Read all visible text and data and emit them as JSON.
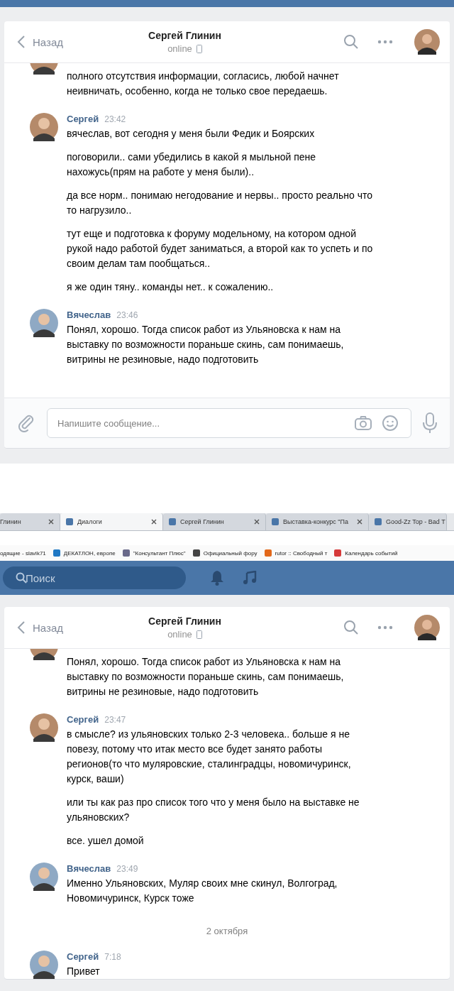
{
  "sections": [
    {
      "kind": "dialog",
      "header": {
        "back": "Назад",
        "name": "Сергей Глинин",
        "status": "online"
      },
      "messages": [
        {
          "kind": "continuation",
          "paragraphs": [
            "полного отсутствия информации, согласись, любой начнет неивничать, особенно, когда не только свое передаешь."
          ]
        },
        {
          "kind": "message",
          "author": "Сергей",
          "time": "23:42",
          "paragraphs": [
            "вячеслав, вот сегодня у меня были Федик и Боярских",
            "поговорили.. сами убедились в какой я мыльной пене нахожусь(прям на работе у меня были)..",
            "да все норм.. понимаю негодование и нервы.. просто реально что то нагрузило..",
            "тут еще и подготовка к форуму модельному, на котором одной рукой надо работой будет заниматься, а второй как то успеть и по своим делам там пообщаться..",
            "я же один тяну.. команды нет.. к сожалению.."
          ]
        },
        {
          "kind": "message",
          "author": "Вячеслав",
          "time": "23:46",
          "paragraphs": [
            "Понял, хорошо. Тогда список работ из Ульяновска к нам на выставку по возможности пораньше скинь, сам понимаешь, витрины не резиновые, надо подготовить"
          ]
        }
      ],
      "composer": {
        "placeholder": "Напишите сообщение..."
      }
    },
    {
      "kind": "browser",
      "tabs": [
        {
          "title": "Глинин",
          "selected": false
        },
        {
          "title": "Диалоги",
          "selected": true
        },
        {
          "title": "Сергей Глинин",
          "selected": false
        },
        {
          "title": "Выставка-конкурс \"Па",
          "selected": false
        },
        {
          "title": "Good-Zz Top - Bad T",
          "selected": false
        }
      ],
      "bookmarks": [
        "одящие - slavik71",
        "ДЕКАТЛОН, европе",
        "\"Консультант Плюс\"",
        "Официальный фору",
        "rutor :: Свободный т",
        "Календарь событий"
      ],
      "search": {
        "placeholder": "Поиск"
      }
    },
    {
      "kind": "dialog",
      "header": {
        "back": "Назад",
        "name": "Сергей Глинин",
        "status": "online"
      },
      "messages": [
        {
          "kind": "continuation",
          "paragraphs": [
            "Понял, хорошо. Тогда список работ из Ульяновска к нам на выставку по возможности пораньше скинь, сам понимаешь, витрины не резиновые, надо подготовить"
          ]
        },
        {
          "kind": "message",
          "author": "Сергей",
          "time": "23:47",
          "paragraphs": [
            "в смысле? из ульяновских только 2-3 человека.. больше я не повезу, потому что итак место все будет занято работы регионов(то что муляровские, сталинградцы, новомичуринск, курск, ваши)",
            "или ты как раз про список того что у меня было на выставке не ульяновских?",
            "все. ушел домой"
          ]
        },
        {
          "kind": "message",
          "author": "Вячеслав",
          "time": "23:49",
          "paragraphs": [
            "Именно Ульяновских, Муляр своих мне скинул, Волгоград, Новомичуринск, Курск тоже"
          ]
        },
        {
          "kind": "date",
          "text": "2 октября"
        },
        {
          "kind": "message",
          "author": "Сергей",
          "time": "7:18",
          "paragraphs": [
            "Привет"
          ]
        }
      ]
    }
  ]
}
